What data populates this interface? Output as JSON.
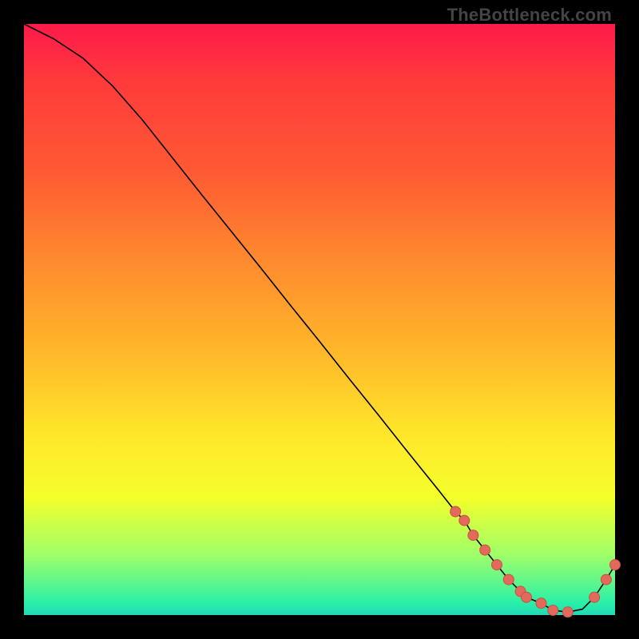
{
  "title": "TheBottleneck.com",
  "chart_data": {
    "type": "line",
    "title": "TheBottleneck.com",
    "xlabel": "",
    "ylabel": "",
    "xlim": [
      0,
      1
    ],
    "ylim": [
      0,
      1
    ],
    "grid": false,
    "legend": false,
    "series": [
      {
        "name": "curve",
        "x": [
          0.0,
          0.05,
          0.1,
          0.15,
          0.2,
          0.25,
          0.3,
          0.35,
          0.4,
          0.45,
          0.5,
          0.55,
          0.6,
          0.65,
          0.7,
          0.73,
          0.745,
          0.76,
          0.78,
          0.8,
          0.82,
          0.84,
          0.85,
          0.875,
          0.895,
          0.92,
          0.945,
          0.965,
          0.985,
          1.0
        ],
        "y": [
          1.0,
          0.975,
          0.942,
          0.895,
          0.838,
          0.775,
          0.712,
          0.65,
          0.588,
          0.525,
          0.463,
          0.4,
          0.338,
          0.275,
          0.213,
          0.175,
          0.16,
          0.135,
          0.11,
          0.085,
          0.06,
          0.04,
          0.03,
          0.02,
          0.008,
          0.005,
          0.01,
          0.03,
          0.06,
          0.085
        ]
      }
    ],
    "markers": [
      {
        "x": 0.73,
        "y": 0.175
      },
      {
        "x": 0.745,
        "y": 0.16
      },
      {
        "x": 0.76,
        "y": 0.135
      },
      {
        "x": 0.78,
        "y": 0.11
      },
      {
        "x": 0.8,
        "y": 0.085
      },
      {
        "x": 0.82,
        "y": 0.06
      },
      {
        "x": 0.84,
        "y": 0.04
      },
      {
        "x": 0.85,
        "y": 0.03
      },
      {
        "x": 0.875,
        "y": 0.02
      },
      {
        "x": 0.895,
        "y": 0.008
      },
      {
        "x": 0.92,
        "y": 0.005
      },
      {
        "x": 0.965,
        "y": 0.03
      },
      {
        "x": 0.985,
        "y": 0.06
      },
      {
        "x": 1.0,
        "y": 0.085
      }
    ],
    "colors": {
      "line": "#000000",
      "marker_fill": "#e26a5d",
      "marker_stroke": "#c94f43"
    }
  }
}
